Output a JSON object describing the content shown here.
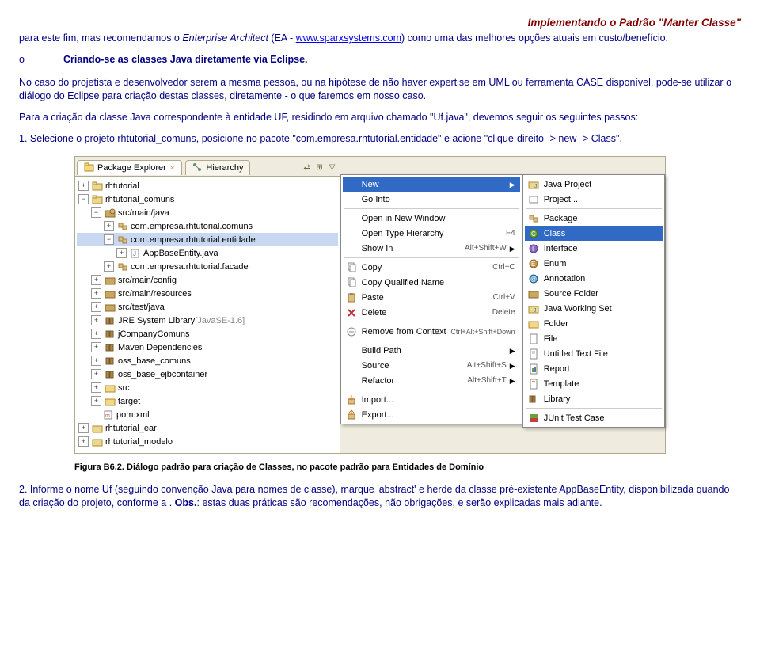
{
  "header": {
    "title": "Implementando o Padrão \"Manter Classe\""
  },
  "intro": {
    "prefix": "para este fim, mas recomendamos o ",
    "tool_italic": "Enterprise Architect",
    "mid": " (EA - ",
    "link": "www.sparxsystems.com",
    "suffix": ") como uma das melhores opções atuais em custo/benefício."
  },
  "bullet": {
    "marker": "o",
    "text": "Criando-se as classes Java diretamente via Eclipse."
  },
  "p2": "No caso do projetista e desenvolvedor serem a mesma pessoa, ou na hipótese de não haver expertise em UML ou ferramenta CASE disponível, pode-se utilizar o diálogo do Eclipse para criação destas classes, diretamente - o que faremos em nosso caso.",
  "p3": "Para a criação da classe Java correspondente à entidade UF, residindo em arquivo chamado \"Uf.java\", devemos seguir os seguintes passos:",
  "p4": "1.      Selecione o projeto rhtutorial_comuns, posicione no pacote \"com.empresa.rhtutorial.entidade\" e acione \"clique-direito -> new -> Class\".",
  "eclipse": {
    "tabs": {
      "explorer": "Package Explorer",
      "hierarchy": "Hierarchy"
    },
    "tree": {
      "n0": "rhtutorial",
      "n1": "rhtutorial_comuns",
      "n2": "src/main/java",
      "n3": "com.empresa.rhtutorial.comuns",
      "n4": "com.empresa.rhtutorial.entidade",
      "n5": "AppBaseEntity.java",
      "n6": "com.empresa.rhtutorial.facade",
      "n7": "src/main/config",
      "n8": "src/main/resources",
      "n9": "src/test/java",
      "n10": "JRE System Library",
      "n10g": " [JavaSE-1.6]",
      "n11": "jCompanyComuns",
      "n12": "Maven Dependencies",
      "n13": "oss_base_comuns",
      "n14": "oss_base_ejbcontainer",
      "n15": "src",
      "n16": "target",
      "n17": "pom.xml",
      "n18": "rhtutorial_ear",
      "n19": "rhtutorial_modelo"
    },
    "menu": {
      "m0": "New",
      "m1": "Go Into",
      "m2": "Open in New Window",
      "m3": "Open Type Hierarchy",
      "m3k": "F4",
      "m4": "Show In",
      "m4k": "Alt+Shift+W",
      "m5": "Copy",
      "m5k": "Ctrl+C",
      "m6": "Copy Qualified Name",
      "m7": "Paste",
      "m7k": "Ctrl+V",
      "m8": "Delete",
      "m8k": "Delete",
      "m9": "Remove from Context",
      "m9k": "Ctrl+Alt+Shift+Down",
      "m10": "Build Path",
      "m11": "Source",
      "m11k": "Alt+Shift+S",
      "m12": "Refactor",
      "m12k": "Alt+Shift+T",
      "m13": "Import...",
      "m14": "Export..."
    },
    "submenu": {
      "s0": "Java Project",
      "s1": "Project...",
      "s2": "Package",
      "s3": "Class",
      "s4": "Interface",
      "s5": "Enum",
      "s6": "Annotation",
      "s7": "Source Folder",
      "s8": "Java Working Set",
      "s9": "Folder",
      "s10": "File",
      "s11": "Untitled Text File",
      "s12": "Report",
      "s13": "Template",
      "s14": "Library",
      "s15": "JUnit Test Case"
    }
  },
  "caption": "Figura B6.2. Diálogo padrão para criação de Classes, no pacote padrão para Entidades de Domínio",
  "p5_prefix": "2.      Informe o nome Uf (seguindo convenção Java para nomes de classe), marque 'abstract' e herde da classe pré-existente AppBaseEntity, disponibilizada quando da criação do projeto, conforme a . ",
  "p5_obs": "Obs.",
  "p5_suffix": ": estas duas práticas são recomendações, não obrigações, e serão explicadas mais adiante."
}
